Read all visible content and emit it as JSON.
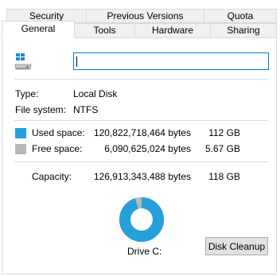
{
  "tabs": {
    "row_back": [
      "Security",
      "Previous Versions",
      "Quota"
    ],
    "row_front": [
      "General",
      "Tools",
      "Hardware",
      "Sharing"
    ],
    "active": "General"
  },
  "drive_name": {
    "value": ""
  },
  "type": {
    "label": "Type:",
    "value": "Local Disk"
  },
  "file_system": {
    "label": "File system:",
    "value": "NTFS"
  },
  "used": {
    "label": "Used space:",
    "bytes": "120,822,718,464 bytes",
    "size": "112 GB",
    "color": "#26a0da"
  },
  "free": {
    "label": "Free space:",
    "bytes": "6,090,625,024 bytes",
    "size": "5.67 GB",
    "color": "#b8b8b8"
  },
  "capacity": {
    "label": "Capacity:",
    "bytes": "126,913,343,488 bytes",
    "size": "118 GB"
  },
  "usage_fraction_used": 0.952,
  "drive_label": "Drive C:",
  "disk_cleanup_label": "Disk Cleanup"
}
